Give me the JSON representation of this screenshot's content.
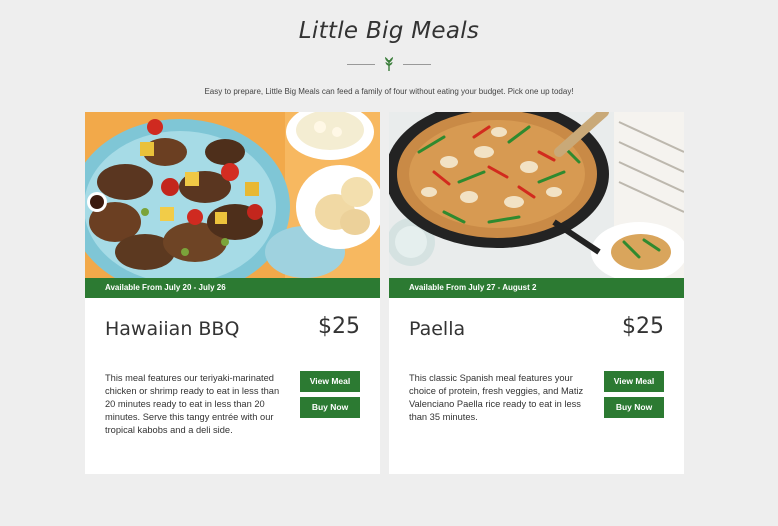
{
  "header": {
    "title": "Little Big Meals",
    "subtitle": "Easy to prepare, Little Big Meals can feed a family of four without eating your budget. Pick one up today!",
    "divider_icon": "sprig-icon"
  },
  "colors": {
    "accent": "#2c7a32",
    "background": "#eeeeee",
    "card": "#ffffff"
  },
  "meals": [
    {
      "image_icon": "hawaiian-bbq-image",
      "availability": "Available From July 20 - July 26",
      "name": "Hawaiian BBQ",
      "price": "$25",
      "description": "This meal features our teriyaki-marinated chicken or shrimp ready to eat in less than 20 minutes ready to eat in less than 20 minutes. Serve this tangy entrée with our tropical kabobs and a deli side.",
      "view_label": "View Meal",
      "buy_label": "Buy Now"
    },
    {
      "image_icon": "paella-image",
      "availability": "Available From July 27 - August 2",
      "name": "Paella",
      "price": "$25",
      "description": "This classic Spanish meal features your choice of protein, fresh veggies, and Matiz Valenciano Paella rice ready to eat in less than 35 minutes.",
      "view_label": "View Meal",
      "buy_label": "Buy Now"
    }
  ]
}
